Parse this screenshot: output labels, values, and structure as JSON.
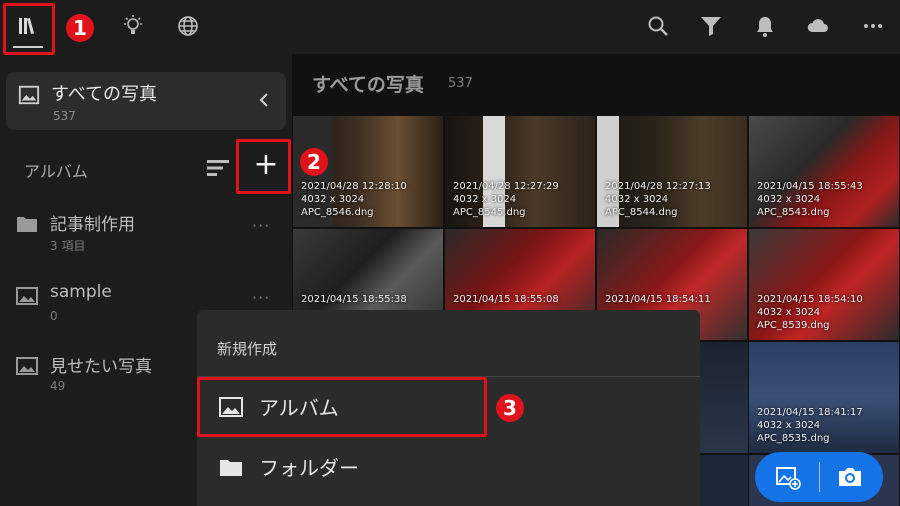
{
  "topbar": {
    "left_icons": [
      "library-icon",
      "lightbulb-icon",
      "globe-icon"
    ],
    "right_icons": [
      "search-icon",
      "filter-icon",
      "bell-icon",
      "cloud-icon",
      "more-icon"
    ]
  },
  "badges": {
    "one": "1",
    "two": "2",
    "three": "3"
  },
  "sidebar": {
    "all_photos": {
      "label": "すべての写真",
      "count": "537"
    },
    "album_header": "アルバム",
    "add_label": "+",
    "items": [
      {
        "name": "記事制作用",
        "sub": "3 項目",
        "icon": "folder-icon"
      },
      {
        "name": "sample",
        "sub": "0",
        "icon": "album-icon"
      },
      {
        "name": "見せたい写真",
        "sub": "49",
        "icon": "album-icon"
      }
    ],
    "more_label": "···"
  },
  "main": {
    "title": "すべての写真",
    "count": "537",
    "thumbs_row1": [
      {
        "date": "2021/04/28 12:28:10",
        "dims": "4032 x 3024",
        "file": "APC_8546.dng"
      },
      {
        "date": "2021/04/28 12:27:29",
        "dims": "4032 x 3024",
        "file": "APC_8545.dng"
      },
      {
        "date": "2021/04/28 12:27:13",
        "dims": "4032 x 3024",
        "file": "APC_8544.dng"
      },
      {
        "date": "2021/04/15 18:55:43",
        "dims": "4032 x 3024",
        "file": "APC_8543.dng"
      }
    ],
    "thumbs_row2": [
      {
        "date": "2021/04/15 18:55:38"
      },
      {
        "date": "2021/04/15 18:55:08"
      },
      {
        "date": "2021/04/15 18:54:11"
      },
      {
        "date": "2021/04/15 18:54:10",
        "dims": "4032 x 3024",
        "file": "APC_8539.dng"
      }
    ],
    "thumb_row3_right": {
      "date": "2021/04/15 18:41:17",
      "dims": "4032 x 3024",
      "file": "APC_8535.dng"
    }
  },
  "sheet": {
    "title": "新規作成",
    "options": [
      {
        "label": "アルバム",
        "icon": "album-icon"
      },
      {
        "label": "フォルダー",
        "icon": "folder-icon"
      }
    ]
  },
  "fab": {
    "left_icon": "add-photo-icon",
    "right_icon": "camera-icon",
    "color": "#1473e6"
  },
  "colors": {
    "highlight": "#e0121b",
    "background": "#151515"
  }
}
